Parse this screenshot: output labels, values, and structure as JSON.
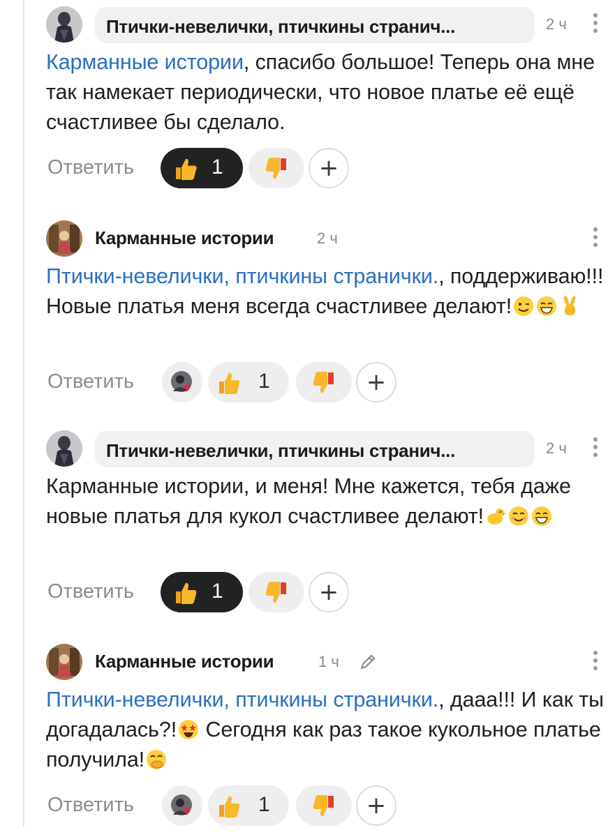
{
  "reply_label": "Ответить",
  "add_reaction_label": "+",
  "comments": [
    {
      "author": "Птички-невелички, птичкины странич...",
      "time": "2 ч",
      "text_prefix": "",
      "mention": "Карманные истории",
      "text": ", спасибо большое! Теперь она мне так намекает периодически, что новое платье её ещё счастливее бы сделало.",
      "likes": "1",
      "liked_by_me": true,
      "reactor_avatar": false,
      "edited": false
    },
    {
      "author": "Карманные истории",
      "time": "2 ч",
      "mention": "Птички-невелички, птичкины странички.",
      "text": ", поддерживаю!!! Новые платья меня всегда счастливее делают!",
      "emojis": [
        "wink-face",
        "grin-sweat-face",
        "victory-hand"
      ],
      "likes": "1",
      "liked_by_me": false,
      "reactor_avatar": true,
      "edited": false
    },
    {
      "author": "Птички-невелички, птичкины странич...",
      "time": "2 ч",
      "mention": "",
      "text": "Карманные истории, и меня! Мне кажется, тебя даже новые платья для кукол счастливее делают!",
      "emojis": [
        "chick",
        "smiling-face",
        "grinning-face"
      ],
      "likes": "1",
      "liked_by_me": true,
      "reactor_avatar": false,
      "edited": false
    },
    {
      "author": "Карманные истории",
      "time": "1 ч",
      "mention": "Птички-невелички, птичкины странички.",
      "text_a": ", дааа!!! И как ты догадалась?!",
      "text_b": " Сегодня как раз такое кукольное платье получила!",
      "emojis": [
        "star-struck-face",
        "hand-over-mouth-face"
      ],
      "likes": "1",
      "liked_by_me": false,
      "reactor_avatar": true,
      "edited": true
    }
  ],
  "colors": {
    "mention": "#2a6fbf",
    "like_active_bg": "#222222",
    "pill_bg": "#f1f1f3",
    "muted_text": "#8c8c8c"
  }
}
